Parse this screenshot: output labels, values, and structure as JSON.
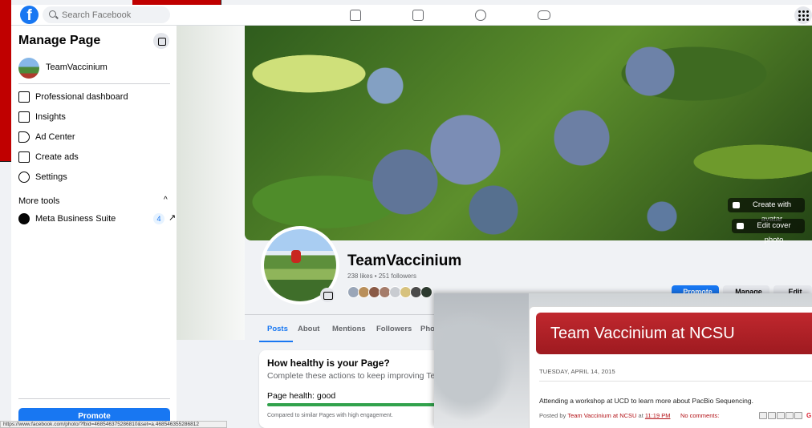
{
  "nav": {
    "search_placeholder": "Search Facebook",
    "logo": "f",
    "icons": [
      "home-icon",
      "video-icon",
      "groups-icon",
      "gaming-icon",
      "menu-grid-icon"
    ]
  },
  "sidebar": {
    "title": "Manage Page",
    "page_name": "TeamVaccinium",
    "items": [
      {
        "label": "Professional dashboard",
        "icon": "dashboard-icon"
      },
      {
        "label": "Insights",
        "icon": "insights-icon"
      },
      {
        "label": "Ad Center",
        "icon": "megaphone-icon"
      },
      {
        "label": "Create ads",
        "icon": "pencil-icon"
      },
      {
        "label": "Settings",
        "icon": "gear-icon"
      }
    ],
    "more_tools": "More tools",
    "meta_business": {
      "label": "Meta Business Suite",
      "badge": "4"
    },
    "promote": "Promote",
    "status_url": "https://www.facebook.com/photo/?fbid=468546375286810&set=a.468546355286812"
  },
  "cover": {
    "create_avatar": "Create with avatar",
    "edit_cover": "Edit cover photo"
  },
  "profile": {
    "name": "TeamVaccinium",
    "stats": "238 likes • 251 followers",
    "actions": {
      "promote": "Promote",
      "manage": "Manage",
      "edit": "Edit"
    }
  },
  "tabs": [
    "Posts",
    "About",
    "Mentions",
    "Followers",
    "Phot"
  ],
  "health": {
    "title": "How healthy is your Page?",
    "subtitle": "Complete these actions to keep improving Team",
    "status": "Page health: good",
    "progress": 0.97,
    "compare": "Compared to similar Pages with high engagement."
  },
  "colors": {
    "fb_blue": "#1877f2",
    "health_green": "#31a24c",
    "blog_red": "#b31217"
  },
  "blog": {
    "title": "Team Vaccinium at NCSU",
    "date": "TUESDAY, APRIL 14, 2015",
    "post": "Attending a workshop at UCD to learn more about PacBio Sequencing.",
    "posted_by_prefix": "Posted by",
    "author": "Team Vaccinium at NCSU",
    "at": "at",
    "time": "11:19 PM",
    "comments": "No comments:",
    "share_g": "G"
  }
}
